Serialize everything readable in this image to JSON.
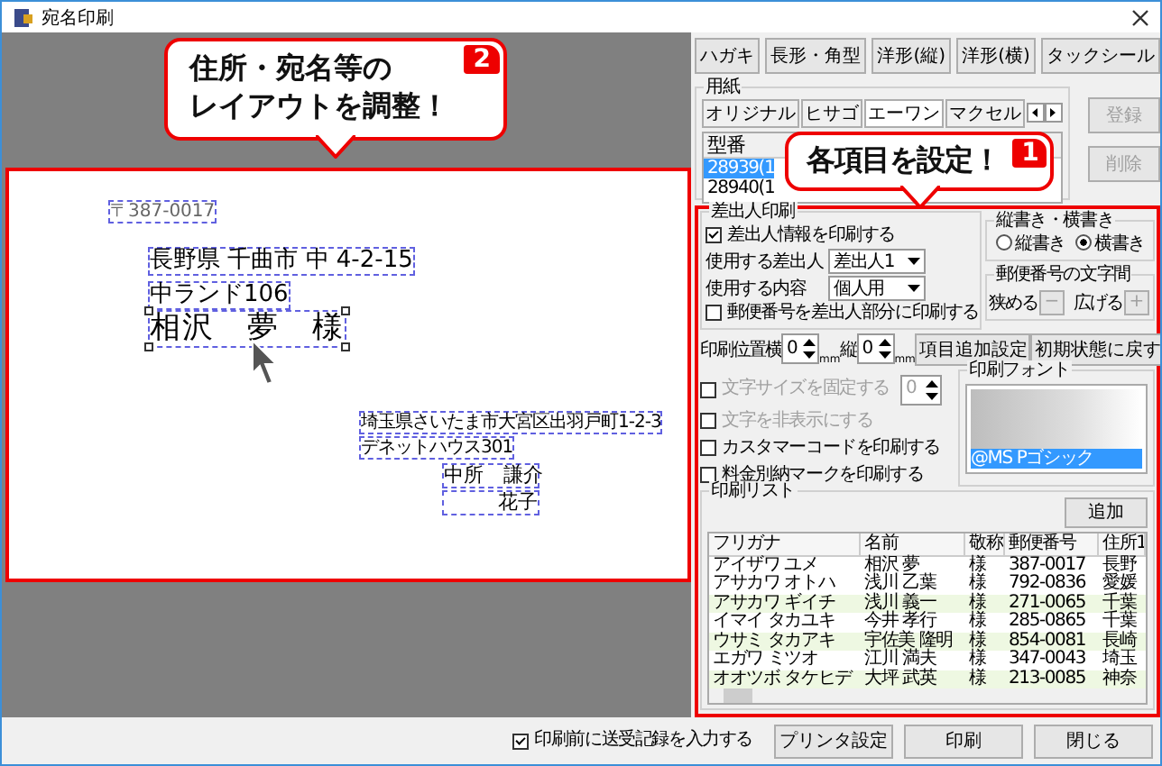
{
  "window": {
    "title": "宛名印刷"
  },
  "envelope_buttons": [
    "ハガキ",
    "長形・角型",
    "洋形(縦)",
    "洋形(横)",
    "タックシール"
  ],
  "paper": {
    "label": "用紙",
    "tabs": [
      {
        "label": "オリジナル",
        "selected": false
      },
      {
        "label": "ヒサゴ",
        "selected": false
      },
      {
        "label": "エーワン",
        "selected": true
      },
      {
        "label": "マクセル",
        "selected": false
      }
    ],
    "list_header": "型番",
    "items": [
      {
        "label": "28939(1",
        "selected": true
      },
      {
        "label": "28940(1",
        "selected": false
      }
    ],
    "buttons": [
      {
        "label": "登録",
        "disabled": true
      },
      {
        "label": "削除",
        "disabled": true
      }
    ]
  },
  "sender": {
    "label": "差出人印刷",
    "print_sender": {
      "label": "差出人情報を印刷する",
      "checked": true
    },
    "fields": [
      {
        "label": "使用する差出人",
        "value": "差出人1"
      },
      {
        "label": "使用する内容",
        "value": "個人用"
      }
    ],
    "print_postcode": {
      "label": "郵便番号を差出人部分に印刷する",
      "checked": false
    }
  },
  "orientation": {
    "label": "縦書き・横書き",
    "options": [
      {
        "label": "縦書き",
        "selected": false
      },
      {
        "label": "横書き",
        "selected": true
      }
    ]
  },
  "postcode_spacing": {
    "label": "郵便番号の文字間",
    "controls": [
      {
        "label": "狭める",
        "button": "−",
        "disabled": true
      },
      {
        "label": "広げる",
        "button": "+",
        "disabled": true
      }
    ]
  },
  "position": {
    "label": "印刷位置",
    "fields": [
      {
        "label": "横",
        "value": "0",
        "unit": "mm"
      },
      {
        "label": "縦",
        "value": "0",
        "unit": "mm"
      }
    ],
    "buttons": [
      "項目追加設定",
      "初期状態に戻す"
    ]
  },
  "options": [
    {
      "label": "文字サイズを固定する",
      "checked": false,
      "disabled": true,
      "value": "0"
    },
    {
      "label": "文字を非表示にする",
      "checked": false,
      "disabled": true
    },
    {
      "label": "カスタマーコードを印刷する",
      "checked": false,
      "disabled": false
    },
    {
      "label": "料金別納マークを印刷する",
      "checked": false,
      "disabled": false
    }
  ],
  "font": {
    "label": "印刷フォント",
    "selected_item": "@MS Pゴシック"
  },
  "print_list": {
    "label": "印刷リスト",
    "add_button": "追加",
    "columns": [
      "フリガナ",
      "名前",
      "敬称",
      "郵便番号",
      "住所1"
    ],
    "rows": [
      [
        "アイザワ ユメ",
        "相沢 夢",
        "様",
        "387-0017",
        "長野"
      ],
      [
        "アサカワ オトハ",
        "浅川 乙葉",
        "様",
        "792-0836",
        "愛媛"
      ],
      [
        "アサカワ ギイチ",
        "浅川 義一",
        "様",
        "271-0065",
        "千葉"
      ],
      [
        "イマイ タカユキ",
        "今井 孝行",
        "様",
        "285-0865",
        "千葉"
      ],
      [
        "ウサミ タカアキ",
        "宇佐美 隆明",
        "様",
        "854-0081",
        "長崎"
      ],
      [
        "エガワ ミツオ",
        "江川 満夫",
        "様",
        "347-0043",
        "埼玉"
      ],
      [
        "オオツボ タケヒデ",
        "大坪 武英",
        "様",
        "213-0085",
        "神奈"
      ]
    ]
  },
  "preview": {
    "recipient": {
      "postcode": "〒387-0017",
      "address_lines": [
        "長野県 千曲市 中 4-2-15",
        "中ランド106"
      ],
      "name": "相沢　夢　様",
      "selected": true
    },
    "sender": {
      "address_lines": [
        "埼玉県さいたま市大宮区出羽戸町1-2-3",
        "デネットハウス301"
      ],
      "names": [
        "中所　謙介",
        "花子"
      ]
    }
  },
  "callouts": [
    {
      "badge": "1",
      "lines": [
        "各項目を設定！"
      ]
    },
    {
      "badge": "2",
      "lines": [
        "住所・宛名等の",
        "レイアウトを調整！"
      ]
    }
  ],
  "footer": {
    "checkbox": {
      "label": "印刷前に送受記録を入力する",
      "checked": true
    },
    "buttons": [
      "プリンタ設定",
      "印刷",
      "閉じる"
    ]
  }
}
